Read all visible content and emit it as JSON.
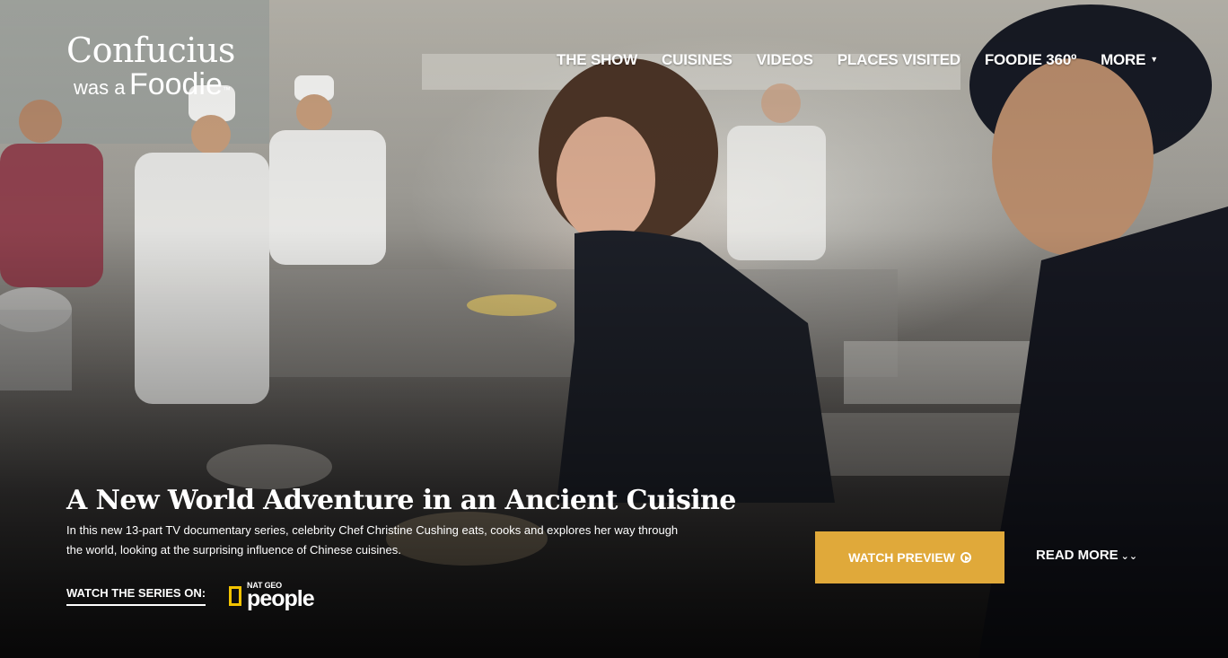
{
  "logo": {
    "line1": "Confucius",
    "line2_small": "was a",
    "line2_big": "Foodie",
    "tm": "™"
  },
  "nav": {
    "items": [
      {
        "label": "THE SHOW"
      },
      {
        "label": "CUISINES"
      },
      {
        "label": "VIDEOS"
      },
      {
        "label": "PLACES VISITED"
      },
      {
        "label": "FOODIE 360º"
      },
      {
        "label": "MORE"
      }
    ]
  },
  "hero": {
    "headline": "A New World Adventure in an Ancient Cuisine",
    "description": "In this new 13-part TV documentary series, celebrity Chef Christine Cushing eats, cooks and explores her way through the world, looking at the surprising influence of Chinese cuisines.",
    "watch_series_label": "WATCH THE SERIES ON:",
    "network_top": "NAT GEO",
    "network_bottom": "people",
    "network_box_color": "#f2c300",
    "watch_preview_label": "WATCH PREVIEW",
    "watch_preview_color": "#e0a93a",
    "read_more_label": "READ MORE"
  }
}
